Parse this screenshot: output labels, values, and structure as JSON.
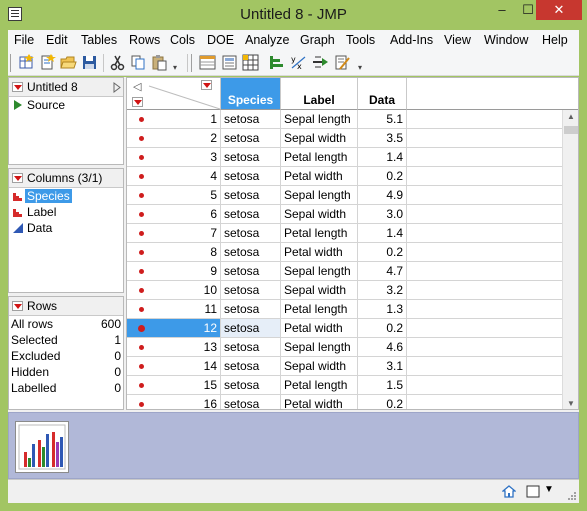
{
  "window": {
    "title": "Untitled 8 - JMP",
    "min_glyph": "–",
    "max_glyph": "☐",
    "close_glyph": "✕"
  },
  "menu": [
    "File",
    "Edit",
    "Tables",
    "Rows",
    "Cols",
    "DOE",
    "Analyze",
    "Graph",
    "Tools",
    "Add-Ins",
    "View",
    "Window",
    "Help"
  ],
  "toolbar": {
    "icons": [
      "new-data-table-icon",
      "new-script-icon",
      "open-icon",
      "save-icon",
      "cut-icon",
      "copy-icon",
      "paste-icon",
      "data-table-list-icon",
      "journal-icon",
      "table-icon",
      "distribution-icon",
      "fit-y-by-x-icon",
      "fit-model-icon",
      "script-icon"
    ],
    "overflow_glyph": "▾"
  },
  "table_panel": {
    "title": "Untitled 8",
    "items": [
      {
        "label": "Source",
        "icon": "run-script-icon"
      }
    ]
  },
  "columns_panel": {
    "title": "Columns (3/1)",
    "items": [
      {
        "label": "Species",
        "icon": "nominal-icon",
        "selected": true
      },
      {
        "label": "Label",
        "icon": "nominal-icon",
        "selected": false
      },
      {
        "label": "Data",
        "icon": "continuous-icon",
        "selected": false
      }
    ]
  },
  "rows_panel": {
    "title": "Rows",
    "items": [
      {
        "label": "All rows",
        "value": "600"
      },
      {
        "label": "Selected",
        "value": "1"
      },
      {
        "label": "Excluded",
        "value": "0"
      },
      {
        "label": "Hidden",
        "value": "0"
      },
      {
        "label": "Labelled",
        "value": "0"
      }
    ]
  },
  "grid": {
    "headers": {
      "species": "Species",
      "label": "Label",
      "data": "Data"
    },
    "selected_column": "Species",
    "rows": [
      {
        "n": "1",
        "species": "setosa",
        "label": "Sepal length",
        "data": "5.1"
      },
      {
        "n": "2",
        "species": "setosa",
        "label": "Sepal width",
        "data": "3.5"
      },
      {
        "n": "3",
        "species": "setosa",
        "label": "Petal length",
        "data": "1.4"
      },
      {
        "n": "4",
        "species": "setosa",
        "label": "Petal width",
        "data": "0.2"
      },
      {
        "n": "5",
        "species": "setosa",
        "label": "Sepal length",
        "data": "4.9"
      },
      {
        "n": "6",
        "species": "setosa",
        "label": "Sepal width",
        "data": "3.0"
      },
      {
        "n": "7",
        "species": "setosa",
        "label": "Petal length",
        "data": "1.4"
      },
      {
        "n": "8",
        "species": "setosa",
        "label": "Petal width",
        "data": "0.2"
      },
      {
        "n": "9",
        "species": "setosa",
        "label": "Sepal length",
        "data": "4.7"
      },
      {
        "n": "10",
        "species": "setosa",
        "label": "Sepal width",
        "data": "3.2"
      },
      {
        "n": "11",
        "species": "setosa",
        "label": "Petal length",
        "data": "1.3"
      },
      {
        "n": "12",
        "species": "setosa",
        "label": "Petal width",
        "data": "0.2",
        "selected": true
      },
      {
        "n": "13",
        "species": "setosa",
        "label": "Sepal length",
        "data": "4.6"
      },
      {
        "n": "14",
        "species": "setosa",
        "label": "Sepal width",
        "data": "3.1"
      },
      {
        "n": "15",
        "species": "setosa",
        "label": "Petal length",
        "data": "1.5"
      },
      {
        "n": "16",
        "species": "setosa",
        "label": "Petal width",
        "data": "0.2"
      }
    ]
  },
  "colors": {
    "frame": "#a2c563",
    "selection": "#3d9ae8",
    "marker": "#cf1d1d",
    "thumb_strip": "#b1b8d8"
  },
  "thumbnail": {
    "icon": "bar-chart-thumbnail-icon"
  },
  "status": {
    "home_icon": "home-icon",
    "window_icon": "window-list-icon",
    "dropdown_glyph": "▼"
  }
}
